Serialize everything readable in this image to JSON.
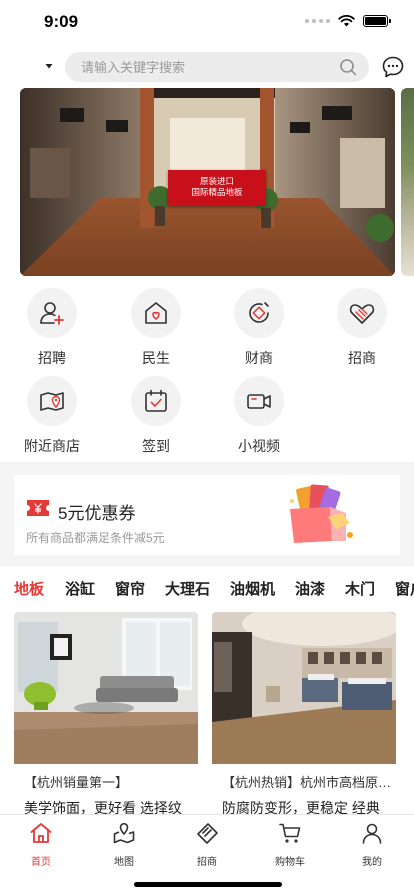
{
  "status_bar": {
    "time": "9:09"
  },
  "search": {
    "placeholder": "请输入关键字搜索"
  },
  "banner": {
    "sign_line1": "原装进口",
    "sign_line2": "国际精品地板"
  },
  "quick_menu": [
    {
      "label": "招聘",
      "icon": "recruit-icon"
    },
    {
      "label": "民生",
      "icon": "livelihood-icon"
    },
    {
      "label": "财商",
      "icon": "finance-icon"
    },
    {
      "label": "招商",
      "icon": "investment-icon"
    },
    {
      "label": "附近商店",
      "icon": "nearby-store-icon"
    },
    {
      "label": "签到",
      "icon": "checkin-icon"
    },
    {
      "label": "小视频",
      "icon": "video-icon"
    }
  ],
  "coupon": {
    "title": "5元优惠券",
    "description": "所有商品都满足条件减5元"
  },
  "categories": [
    "地板",
    "浴缸",
    "窗帘",
    "大理石",
    "油烟机",
    "油漆",
    "木门",
    "窗户"
  ],
  "products": [
    {
      "title": "【杭州销量第一】",
      "description": "美学饰面，更好看 选择纹"
    },
    {
      "title": "【杭州热销】杭州市高档原…",
      "description": "防腐防变形，更稳定 经典"
    }
  ],
  "tab_bar": [
    {
      "label": "首页",
      "icon": "home-icon"
    },
    {
      "label": "地图",
      "icon": "map-icon"
    },
    {
      "label": "招商",
      "icon": "investment-tab-icon"
    },
    {
      "label": "购物车",
      "icon": "cart-icon"
    },
    {
      "label": "我的",
      "icon": "profile-icon"
    }
  ],
  "colors": {
    "accent": "#e53935",
    "icon_stroke": "#333333",
    "background": "#f5f5f5"
  }
}
